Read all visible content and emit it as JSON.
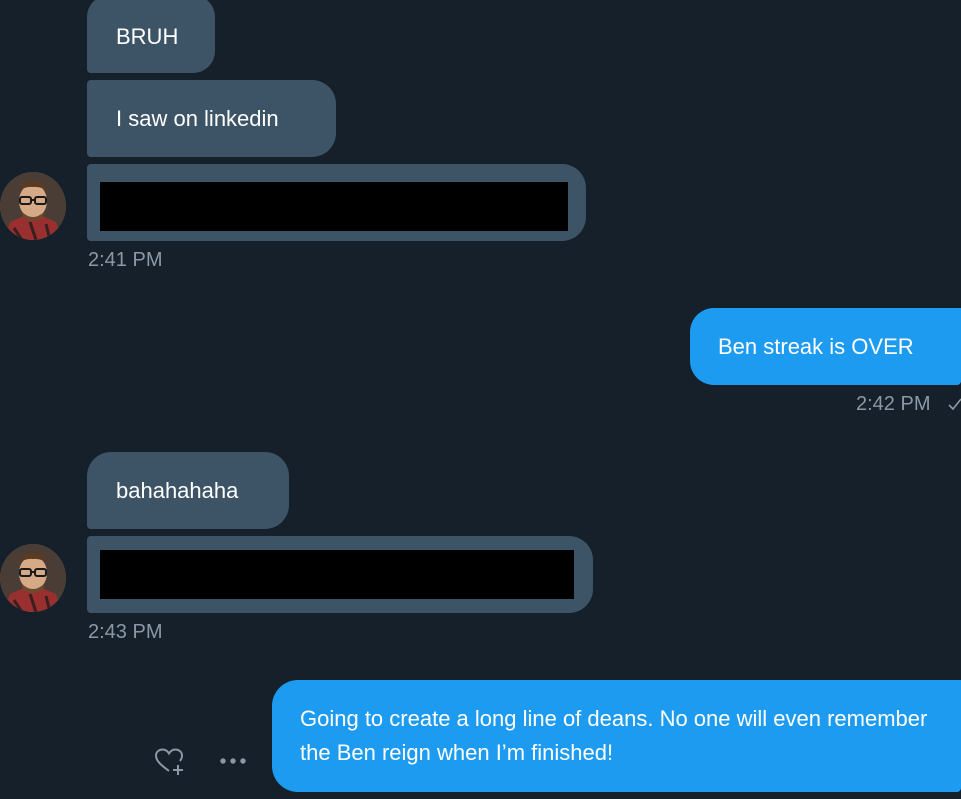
{
  "conversation": {
    "messages": [
      {
        "direction": "incoming",
        "text": "BRUH"
      },
      {
        "direction": "incoming",
        "text": "I saw on linkedin"
      },
      {
        "direction": "incoming",
        "text": "",
        "redacted": true
      },
      {
        "direction": "outgoing",
        "text": "Ben streak is OVER"
      },
      {
        "direction": "incoming",
        "text": "bahahahaha"
      },
      {
        "direction": "incoming",
        "text": "",
        "redacted": true
      },
      {
        "direction": "outgoing",
        "text": "Going to create a long line of deans. No one will even remember the Ben reign when I’m finished!"
      }
    ],
    "timestamps": [
      "2:41 PM",
      "2:42 PM",
      "2:43 PM"
    ],
    "outgoing_status_glyph": "✓"
  },
  "icons": {
    "react": "heart-plus-icon",
    "more": "more-horizontal-icon",
    "sent_status": "checkmark-icon"
  },
  "colors": {
    "background": "#15202b",
    "incoming_bubble": "#3d5466",
    "outgoing_bubble": "#1d9bf0",
    "timestamp": "#8b98a5",
    "redaction": "#000000"
  }
}
